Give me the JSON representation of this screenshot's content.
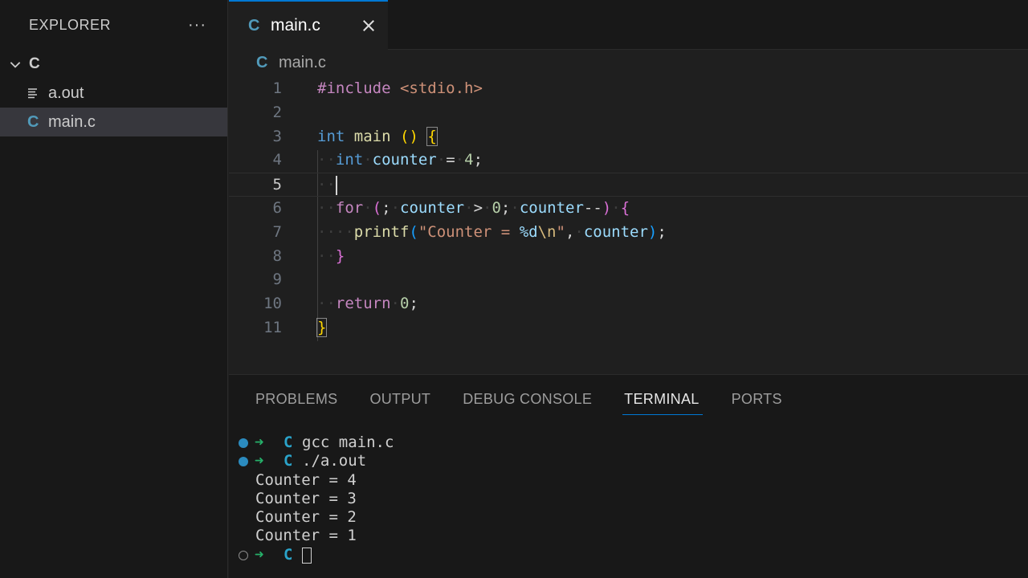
{
  "sidebar": {
    "title": "EXPLORER",
    "more": "···",
    "folder": "C",
    "files": [
      {
        "icon": "text-file-icon",
        "label": "a.out"
      },
      {
        "icon": "c-file-icon",
        "label": "main.c"
      }
    ]
  },
  "editor": {
    "tab_label": "main.c",
    "tab_icon": "C",
    "breadcrumb": "main.c",
    "active_line": 5,
    "lines": [
      {
        "n": "1",
        "tokens": [
          [
            "k-purple",
            "#include"
          ],
          [
            "k-plain",
            " "
          ],
          [
            "k-str",
            "<stdio.h>"
          ]
        ]
      },
      {
        "n": "2",
        "tokens": []
      },
      {
        "n": "3",
        "tokens": [
          [
            "k-blue",
            "int"
          ],
          [
            "k-plain",
            " "
          ],
          [
            "k-fn",
            "main"
          ],
          [
            "k-plain",
            " "
          ],
          [
            "k-brk1",
            "()"
          ],
          [
            "k-plain",
            " "
          ],
          [
            "k-brk1 bracket-match",
            "{"
          ]
        ]
      },
      {
        "n": "4",
        "tokens": [
          [
            "ws",
            "··"
          ],
          [
            "k-blue",
            "int"
          ],
          [
            "ws",
            "·"
          ],
          [
            "k-var",
            "counter"
          ],
          [
            "ws",
            "·"
          ],
          [
            "k-plain",
            "="
          ],
          [
            "ws",
            "·"
          ],
          [
            "k-num",
            "4"
          ],
          [
            "k-plain",
            ";"
          ]
        ]
      },
      {
        "n": "5",
        "tokens": [
          [
            "ws",
            "··"
          ],
          [
            "cursor",
            ""
          ]
        ]
      },
      {
        "n": "6",
        "tokens": [
          [
            "ws",
            "··"
          ],
          [
            "k-purple",
            "for"
          ],
          [
            "ws",
            "·"
          ],
          [
            "k-brk2",
            "("
          ],
          [
            "k-plain",
            ";"
          ],
          [
            "ws",
            "·"
          ],
          [
            "k-var",
            "counter"
          ],
          [
            "ws",
            "·"
          ],
          [
            "k-plain",
            ">"
          ],
          [
            "ws",
            "·"
          ],
          [
            "k-num",
            "0"
          ],
          [
            "k-plain",
            ";"
          ],
          [
            "ws",
            "·"
          ],
          [
            "k-var",
            "counter"
          ],
          [
            "k-plain",
            "--"
          ],
          [
            "k-brk2",
            ")"
          ],
          [
            "ws",
            "·"
          ],
          [
            "k-brk2",
            "{"
          ]
        ]
      },
      {
        "n": "7",
        "tokens": [
          [
            "ws",
            "····"
          ],
          [
            "k-fn",
            "printf"
          ],
          [
            "k-brk3",
            "("
          ],
          [
            "k-str",
            "\"Counter = "
          ],
          [
            "k-var",
            "%d"
          ],
          [
            "k-esc",
            "\\n"
          ],
          [
            "k-str",
            "\""
          ],
          [
            "k-plain",
            ","
          ],
          [
            "ws",
            "·"
          ],
          [
            "k-var",
            "counter"
          ],
          [
            "k-brk3",
            ")"
          ],
          [
            "k-plain",
            ";"
          ]
        ]
      },
      {
        "n": "8",
        "tokens": [
          [
            "ws",
            "··"
          ],
          [
            "k-brk2",
            "}"
          ]
        ]
      },
      {
        "n": "9",
        "tokens": []
      },
      {
        "n": "10",
        "tokens": [
          [
            "ws",
            "··"
          ],
          [
            "k-purple",
            "return"
          ],
          [
            "ws",
            "·"
          ],
          [
            "k-num",
            "0"
          ],
          [
            "k-plain",
            ";"
          ]
        ]
      },
      {
        "n": "11",
        "tokens": [
          [
            "k-brk1 bracket-match",
            "}"
          ]
        ]
      }
    ]
  },
  "panel": {
    "tabs": [
      "PROBLEMS",
      "OUTPUT",
      "DEBUG CONSOLE",
      "TERMINAL",
      "PORTS"
    ],
    "active_tab": "TERMINAL",
    "terminal": [
      {
        "kind": "prompt",
        "status": "filled",
        "arrow": "➜",
        "dir": "C",
        "cmd": "gcc main.c"
      },
      {
        "kind": "prompt",
        "status": "filled",
        "arrow": "➜",
        "dir": "C",
        "cmd": "./a.out"
      },
      {
        "kind": "output",
        "text": "Counter = 4"
      },
      {
        "kind": "output",
        "text": "Counter = 3"
      },
      {
        "kind": "output",
        "text": "Counter = 2"
      },
      {
        "kind": "output",
        "text": "Counter = 1"
      },
      {
        "kind": "prompt",
        "status": "hollow",
        "arrow": "➜",
        "dir": "C",
        "cmd": ""
      }
    ]
  }
}
